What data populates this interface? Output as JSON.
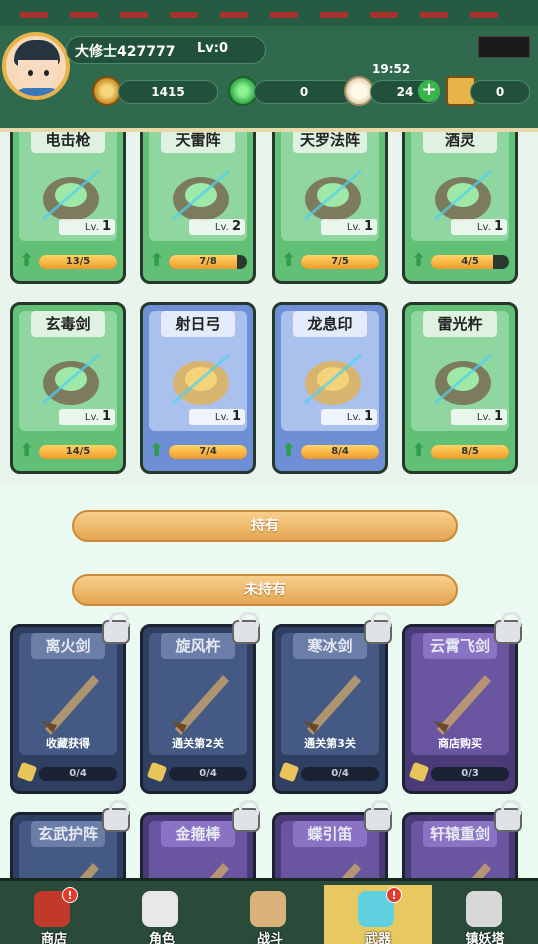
{
  "player": {
    "name": "大修士427777",
    "level": "Lv:0",
    "time": "19:52"
  },
  "resources": {
    "coins": "1415",
    "jade": "0",
    "buns": "24",
    "scrolls": "0"
  },
  "owned": [
    {
      "name": "电击枪",
      "lv": "1",
      "progress": "13/5",
      "fill": 1.0,
      "style": "green",
      "icon": "shock-gun-icon"
    },
    {
      "name": "天雷阵",
      "lv": "2",
      "progress": "7/8",
      "fill": 0.875,
      "style": "green",
      "icon": "thunder-cube-icon"
    },
    {
      "name": "天罗法阵",
      "lv": "1",
      "progress": "7/5",
      "fill": 1.0,
      "style": "green",
      "icon": "talisman-array-icon"
    },
    {
      "name": "酒灵",
      "lv": "1",
      "progress": "4/5",
      "fill": 0.8,
      "style": "green",
      "icon": "wine-jar-icon"
    },
    {
      "name": "玄毒剑",
      "lv": "1",
      "progress": "14/5",
      "fill": 1.0,
      "style": "green",
      "icon": "poison-sword-icon"
    },
    {
      "name": "射日弓",
      "lv": "1",
      "progress": "7/4",
      "fill": 1.0,
      "style": "blue",
      "icon": "sun-bow-icon"
    },
    {
      "name": "龙息印",
      "lv": "1",
      "progress": "8/4",
      "fill": 1.0,
      "style": "blue",
      "icon": "dragon-seal-icon"
    },
    {
      "name": "雷光杵",
      "lv": "1",
      "progress": "8/5",
      "fill": 1.0,
      "style": "green",
      "icon": "lightning-pestle-icon"
    }
  ],
  "sections": {
    "owned": "持有",
    "unowned": "未持有"
  },
  "unowned": [
    {
      "name": "离火剑",
      "condition": "收藏获得",
      "progress": "0/4",
      "style": "dark",
      "icon": "fire-sword-icon"
    },
    {
      "name": "旋风杵",
      "condition": "通关第2关",
      "progress": "0/4",
      "style": "dark",
      "icon": "whirlwind-pestle-icon"
    },
    {
      "name": "寒冰剑",
      "condition": "通关第3关",
      "progress": "0/4",
      "style": "dark",
      "icon": "ice-sword-icon"
    },
    {
      "name": "云霄飞剑",
      "condition": "商店购买",
      "progress": "0/3",
      "style": "violet",
      "icon": "cloud-sword-icon"
    },
    {
      "name": "玄武护阵",
      "style": "dark",
      "icon": "turtle-array-icon"
    },
    {
      "name": "金箍棒",
      "style": "violet",
      "icon": "golden-staff-icon"
    },
    {
      "name": "蝶引笛",
      "style": "violet",
      "icon": "butterfly-flute-icon"
    },
    {
      "name": "轩辕重剑",
      "style": "violet",
      "icon": "heavy-sword-icon"
    }
  ],
  "nav": [
    {
      "label": "商店",
      "icon": "shop-icon",
      "badge": "!"
    },
    {
      "label": "角色",
      "icon": "character-icon",
      "badge": ""
    },
    {
      "label": "战斗",
      "icon": "battle-sword-icon",
      "badge": ""
    },
    {
      "label": "武器",
      "icon": "weapon-icon",
      "badge": "!",
      "active": true
    },
    {
      "label": "镇妖塔",
      "icon": "tower-icon",
      "badge": ""
    }
  ],
  "colors": {
    "header": "#2f6a4f",
    "gold": "#e8b44a",
    "progress": "#f09a2a",
    "upgrade": "#2f9d4b"
  }
}
